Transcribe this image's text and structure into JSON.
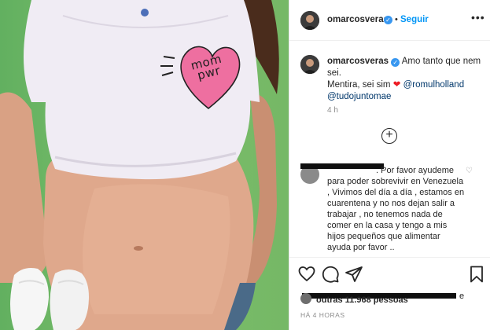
{
  "post": {
    "username": "omarcosveras",
    "separator": "•",
    "follow_label": "Seguir",
    "more_icon": "•••"
  },
  "photo": {
    "shirt_text_line1": "mom",
    "shirt_text_line2": "pwr"
  },
  "caption": {
    "username": "omarcosveras",
    "text": "Amo tanto que nem sei.",
    "line2": "Mentira, sei sim",
    "heart_emoji": "❤",
    "mention1": "@romulholland",
    "mention2": "@tudojuntomae",
    "time": "4 h"
  },
  "load_more_icon": "+",
  "comment": {
    "text": ". Por favor ayudeme para poder sobrevivir en Venezuela , Vivimos del día a día , estamos en cuarentena y no nos dejan salir a trabajar , no tenemos nada de comer en la casa y tengo a mis hijos pequeños que alimentar ayuda por favor .."
  },
  "likes": {
    "suffix": "e",
    "others": "outras 11.968 pessoas"
  },
  "date": "HÁ 4 HORAS",
  "colors": {
    "accent": "#0095f6",
    "verified": "#3897f0",
    "mention": "#00376b",
    "muted": "#8e8e8e",
    "heart": "#ed1c24"
  }
}
